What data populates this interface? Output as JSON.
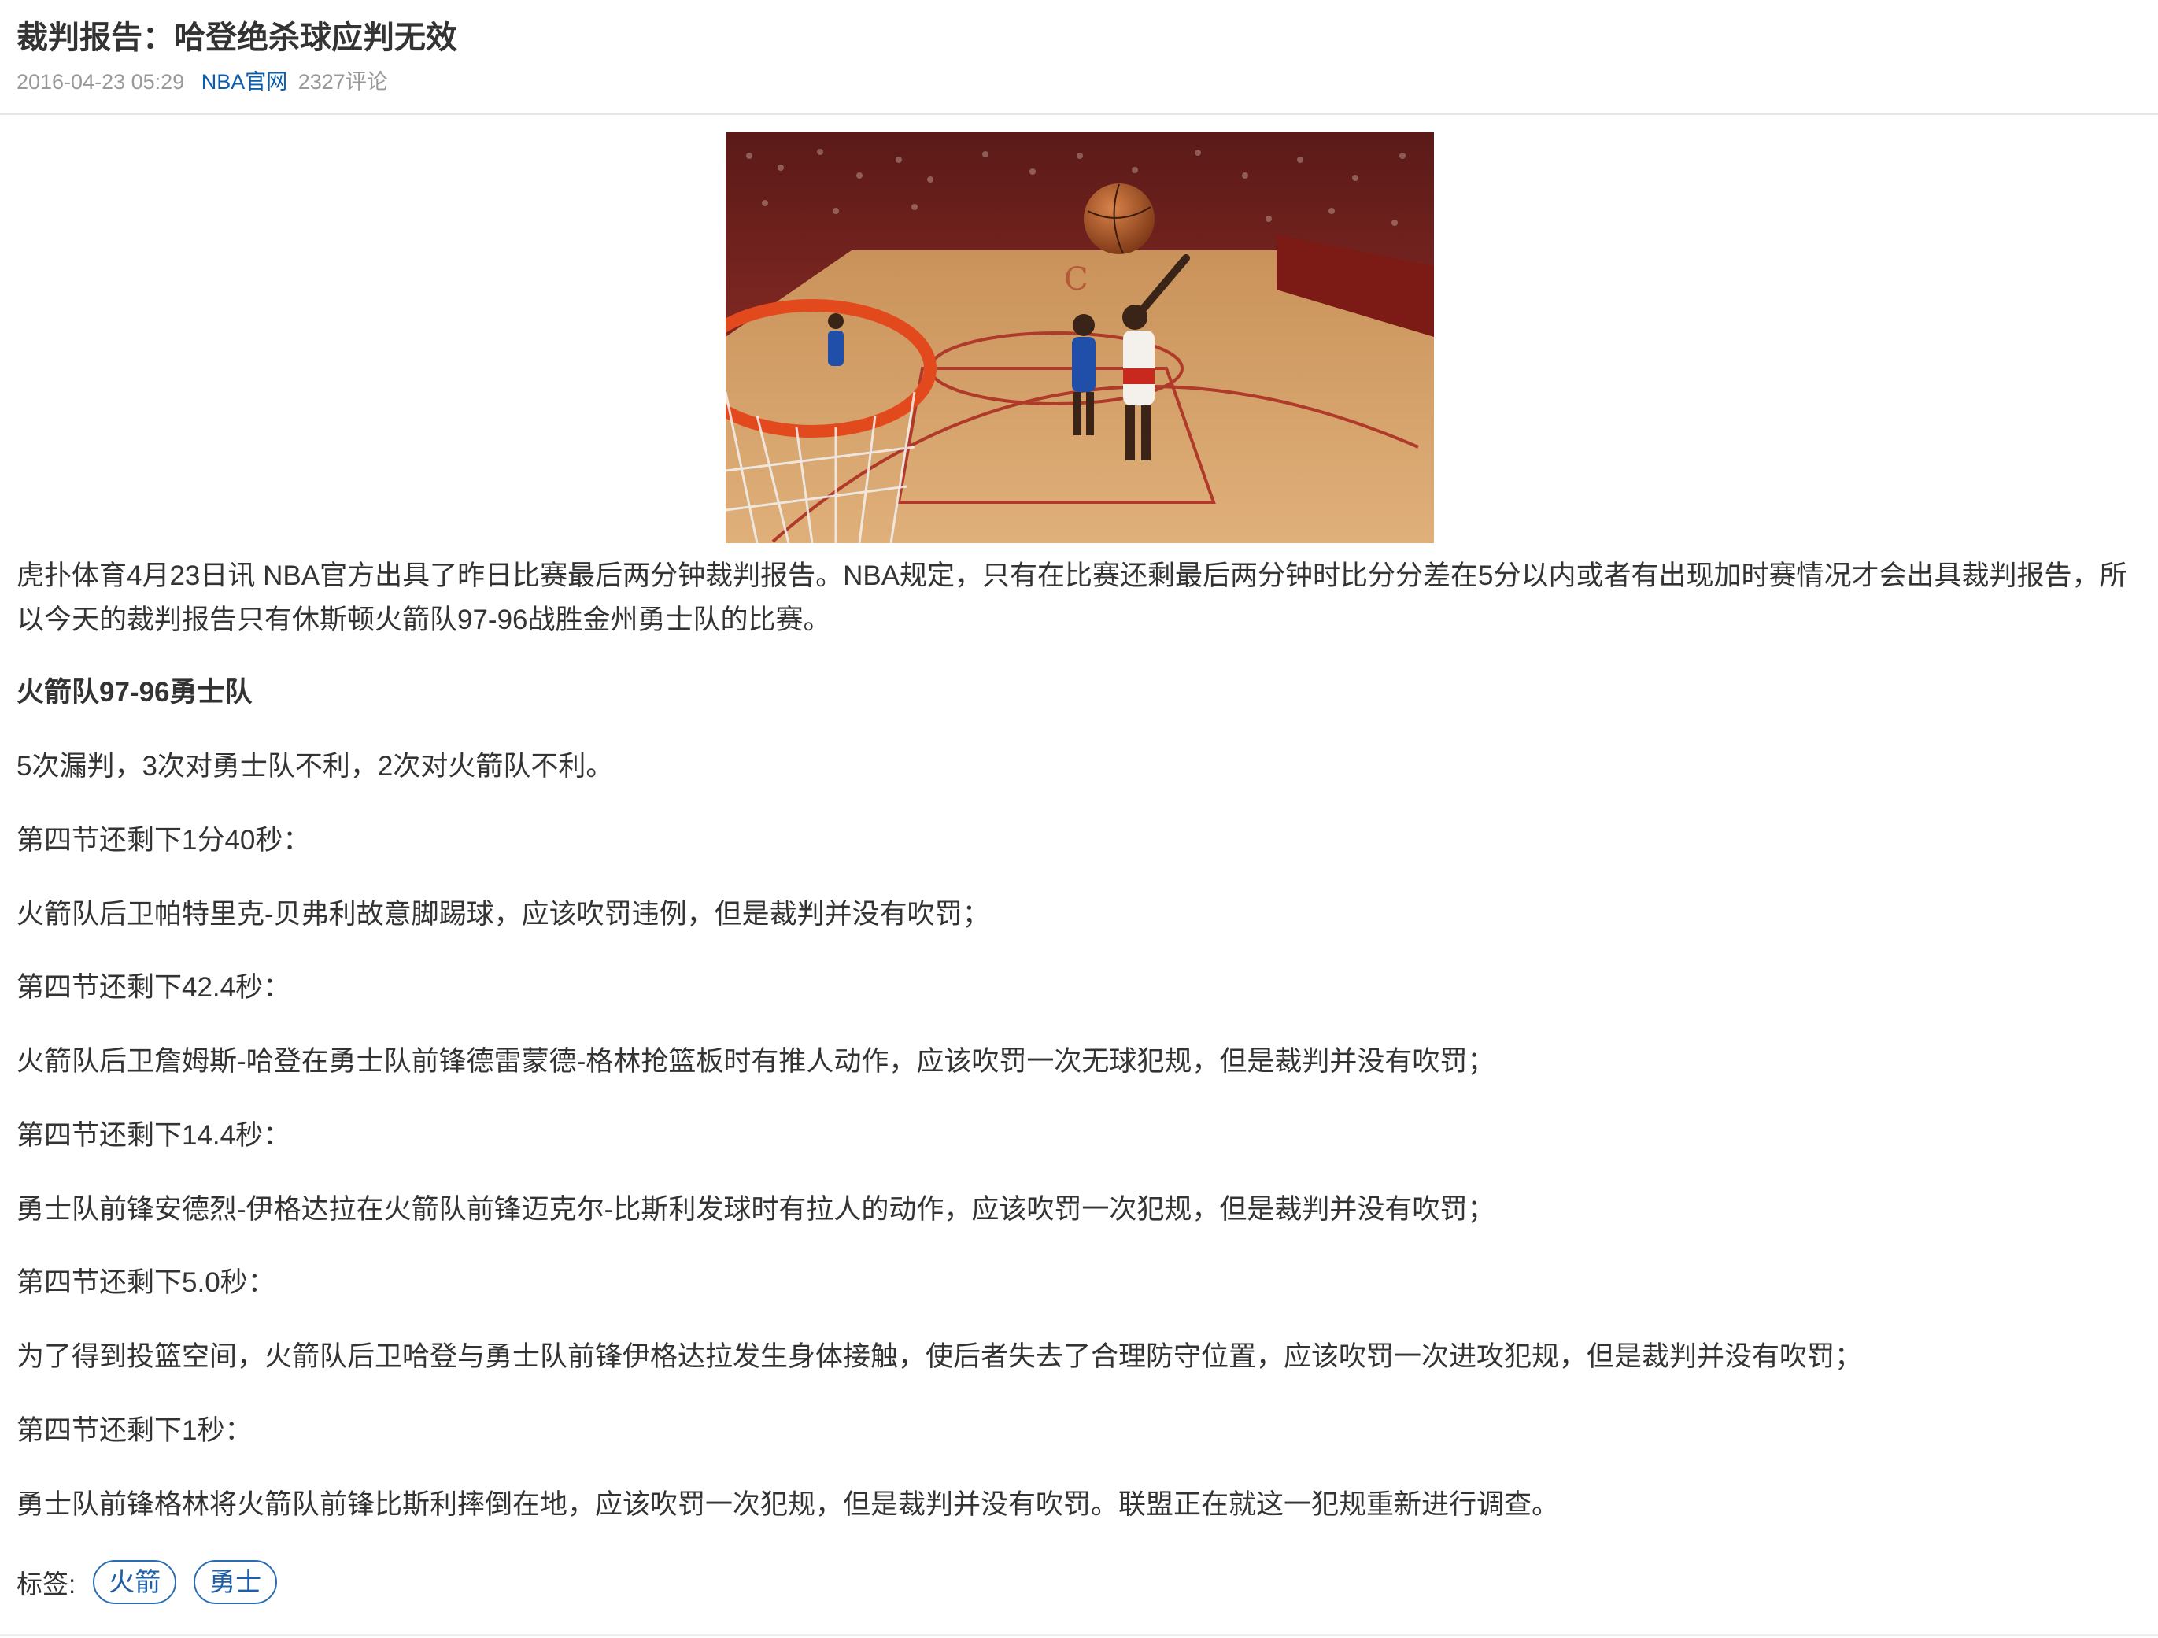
{
  "article": {
    "title": "裁判报告：哈登绝杀球应判无效",
    "date": "2016-04-23 05:29",
    "source": "NBA官网",
    "comments": "2327评论"
  },
  "body": {
    "intro": "虎扑体育4月23日讯 NBA官方出具了昨日比赛最后两分钟裁判报告。NBA规定，只有在比赛还剩最后两分钟时比分分差在5分以内或者有出现加时赛情况才会出具裁判报告，所以今天的裁判报告只有休斯顿火箭队97-96战胜金州勇士队的比赛。",
    "game_heading": "火箭队97-96勇士队",
    "summary": "5次漏判，3次对勇士队不利，2次对火箭队不利。",
    "t1": "第四节还剩下1分40秒：",
    "d1": "火箭队后卫帕特里克-贝弗利故意脚踢球，应该吹罚违例，但是裁判并没有吹罚；",
    "t2": "第四节还剩下42.4秒：",
    "d2": "火箭队后卫詹姆斯-哈登在勇士队前锋德雷蒙德-格林抢篮板时有推人动作，应该吹罚一次无球犯规，但是裁判并没有吹罚；",
    "t3": "第四节还剩下14.4秒：",
    "d3": "勇士队前锋安德烈-伊格达拉在火箭队前锋迈克尔-比斯利发球时有拉人的动作，应该吹罚一次犯规，但是裁判并没有吹罚；",
    "t4": "第四节还剩下5.0秒：",
    "d4": "为了得到投篮空间，火箭队后卫哈登与勇士队前锋伊格达拉发生身体接触，使后者失去了合理防守位置，应该吹罚一次进攻犯规，但是裁判并没有吹罚；",
    "t5": "第四节还剩下1秒：",
    "d5": "勇士队前锋格林将火箭队前锋比斯利摔倒在地，应该吹罚一次犯规，但是裁判并没有吹罚。联盟正在就这一犯规重新进行调查。"
  },
  "tags": {
    "label": "标签:",
    "items": [
      "火箭",
      "勇士"
    ]
  },
  "colors": {
    "link": "#0b5ead",
    "meta": "#999999",
    "text": "#333333",
    "tag_border": "#2b6cb0"
  }
}
